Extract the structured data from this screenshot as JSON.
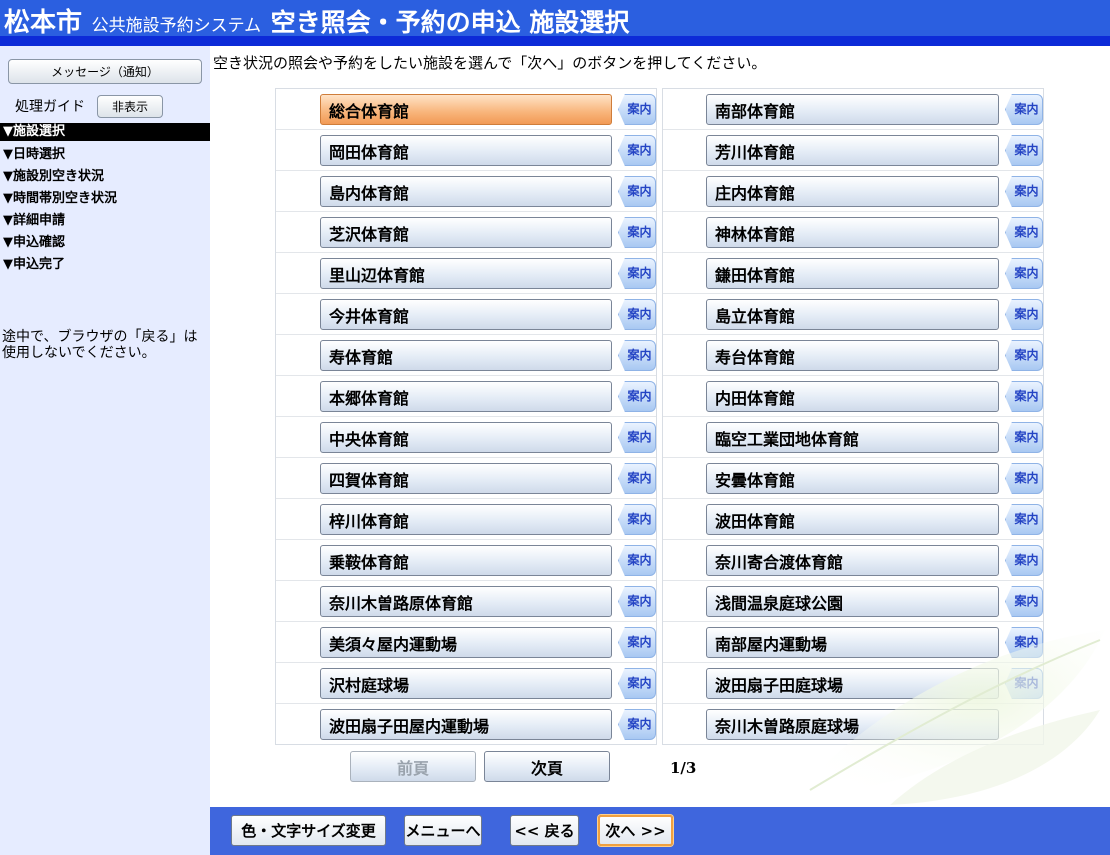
{
  "header": {
    "city": "松本市",
    "system": "公共施設予約システム",
    "page_title": "空き照会・予約の申込 施設選択"
  },
  "sidebar": {
    "message_button": "メッセージ（通知）",
    "guide_label": "処理ガイド",
    "hide_button": "非表示",
    "steps": [
      {
        "label": "▼施設選択",
        "active": true
      },
      {
        "label": "▼日時選択",
        "active": false
      },
      {
        "label": "▼施設別空き状況",
        "active": false
      },
      {
        "label": "▼時間帯別空き状況",
        "active": false
      },
      {
        "label": "▼詳細申請",
        "active": false
      },
      {
        "label": "▼申込確認",
        "active": false
      },
      {
        "label": "▼申込完了",
        "active": false
      }
    ],
    "note": "途中で、ブラウザの「戻る」は使用しないでください。"
  },
  "main": {
    "instruction": "空き状況の照会や予約をしたい施設を選んで「次へ」のボタンを押してください。",
    "info_label": "案内",
    "left_facilities": [
      {
        "name": "総合体育館",
        "selected": true,
        "has_info": true
      },
      {
        "name": "岡田体育館",
        "selected": false,
        "has_info": true
      },
      {
        "name": "島内体育館",
        "selected": false,
        "has_info": true
      },
      {
        "name": "芝沢体育館",
        "selected": false,
        "has_info": true
      },
      {
        "name": "里山辺体育館",
        "selected": false,
        "has_info": true
      },
      {
        "name": "今井体育館",
        "selected": false,
        "has_info": true
      },
      {
        "name": "寿体育館",
        "selected": false,
        "has_info": true
      },
      {
        "name": "本郷体育館",
        "selected": false,
        "has_info": true
      },
      {
        "name": "中央体育館",
        "selected": false,
        "has_info": true
      },
      {
        "name": "四賀体育館",
        "selected": false,
        "has_info": true
      },
      {
        "name": "梓川体育館",
        "selected": false,
        "has_info": true
      },
      {
        "name": "乗鞍体育館",
        "selected": false,
        "has_info": true
      },
      {
        "name": "奈川木曽路原体育館",
        "selected": false,
        "has_info": true
      },
      {
        "name": "美須々屋内運動場",
        "selected": false,
        "has_info": true
      },
      {
        "name": "沢村庭球場",
        "selected": false,
        "has_info": true
      },
      {
        "name": "波田扇子田屋内運動場",
        "selected": false,
        "has_info": true
      }
    ],
    "right_facilities": [
      {
        "name": "南部体育館",
        "selected": false,
        "has_info": true
      },
      {
        "name": "芳川体育館",
        "selected": false,
        "has_info": true
      },
      {
        "name": "庄内体育館",
        "selected": false,
        "has_info": true
      },
      {
        "name": "神林体育館",
        "selected": false,
        "has_info": true
      },
      {
        "name": "鎌田体育館",
        "selected": false,
        "has_info": true
      },
      {
        "name": "島立体育館",
        "selected": false,
        "has_info": true
      },
      {
        "name": "寿台体育館",
        "selected": false,
        "has_info": true
      },
      {
        "name": "内田体育館",
        "selected": false,
        "has_info": true
      },
      {
        "name": "臨空工業団地体育館",
        "selected": false,
        "has_info": true
      },
      {
        "name": "安曇体育館",
        "selected": false,
        "has_info": true
      },
      {
        "name": "波田体育館",
        "selected": false,
        "has_info": true
      },
      {
        "name": "奈川寄合渡体育館",
        "selected": false,
        "has_info": true
      },
      {
        "name": "浅間温泉庭球公園",
        "selected": false,
        "has_info": true
      },
      {
        "name": "南部屋内運動場",
        "selected": false,
        "has_info": true
      },
      {
        "name": "波田扇子田庭球場",
        "selected": false,
        "has_info": true
      },
      {
        "name": "奈川木曽路原庭球場",
        "selected": false,
        "has_info": false
      }
    ],
    "pager": {
      "prev_label": "前頁",
      "next_label": "次頁",
      "page_indicator": "1/3"
    }
  },
  "footer": {
    "color_size_button": "色・文字サイズ変更",
    "menu_button": "メニューへ",
    "back_button": "<< 戻る",
    "next_button": "次へ >>"
  },
  "colors": {
    "header_bg": "#2b5fe0",
    "sidebar_bg": "#e6ecff",
    "footer_bg": "#3f66dd",
    "selected_button": "#f8b47a",
    "info_tag_text": "#2444c4"
  }
}
